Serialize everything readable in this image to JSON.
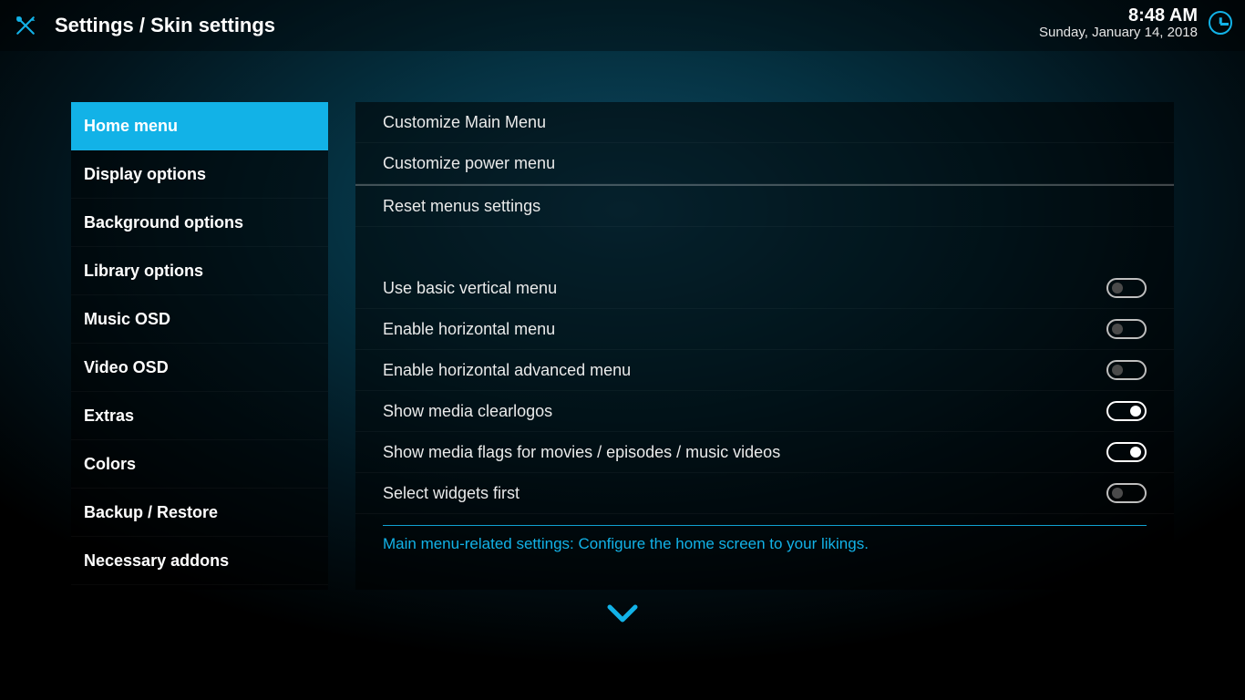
{
  "header": {
    "breadcrumb": "Settings / Skin settings",
    "time": "8:48 AM",
    "date": "Sunday, January 14, 2018"
  },
  "sidebar": {
    "items": [
      {
        "label": "Home menu",
        "selected": true
      },
      {
        "label": "Display options",
        "selected": false
      },
      {
        "label": "Background options",
        "selected": false
      },
      {
        "label": "Library options",
        "selected": false
      },
      {
        "label": "Music OSD",
        "selected": false
      },
      {
        "label": "Video OSD",
        "selected": false
      },
      {
        "label": "Extras",
        "selected": false
      },
      {
        "label": "Colors",
        "selected": false
      },
      {
        "label": "Backup / Restore",
        "selected": false
      },
      {
        "label": "Necessary addons",
        "selected": false
      }
    ]
  },
  "panel": {
    "actions": [
      {
        "label": "Customize Main Menu"
      },
      {
        "label": "Customize power menu"
      },
      {
        "label": "Reset menus settings"
      }
    ],
    "toggles": [
      {
        "label": "Use basic vertical menu",
        "on": false
      },
      {
        "label": "Enable horizontal menu",
        "on": false
      },
      {
        "label": "Enable horizontal advanced menu",
        "on": false
      },
      {
        "label": "Show media clearlogos",
        "on": true
      },
      {
        "label": "Show media flags for movies / episodes / music videos",
        "on": true
      },
      {
        "label": "Select widgets first",
        "on": false
      }
    ],
    "description": "Main menu-related settings: Configure the home screen to your likings."
  },
  "colors": {
    "accent": "#12b2e7"
  }
}
